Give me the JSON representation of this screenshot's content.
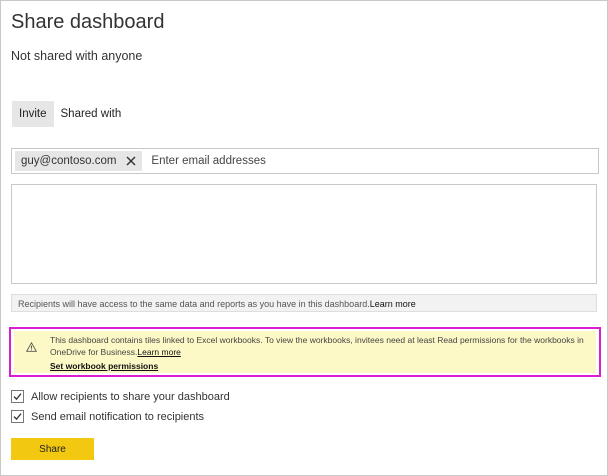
{
  "dialog": {
    "title": "Share dashboard",
    "status": "Not shared with anyone"
  },
  "tabs": [
    {
      "label": "Invite",
      "active": true
    },
    {
      "label": "Shared with",
      "active": false
    }
  ],
  "recipients": {
    "chips": [
      "guy@contoso.com"
    ],
    "placeholder": "Enter email addresses"
  },
  "info": {
    "text": "Recipients will have access to the same data and reports as you have in this dashboard.",
    "link": "Learn more"
  },
  "warning": {
    "icon": "warning-icon",
    "text": "This dashboard contains tiles linked to Excel workbooks. To view the workbooks, invitees need at least Read permissions for the workbooks in OneDrive for Business.",
    "link": "Learn more",
    "action": "Set workbook permissions",
    "highlight_color": "#d91ed1",
    "background_color": "#fdf9c6"
  },
  "options": [
    {
      "label": "Allow recipients to share your dashboard",
      "checked": true
    },
    {
      "label": "Send email notification to recipients",
      "checked": true
    }
  ],
  "share_button": {
    "label": "Share",
    "color": "#f2c811"
  }
}
